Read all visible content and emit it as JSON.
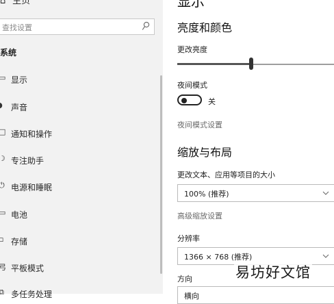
{
  "sidebar": {
    "home_label": "主页",
    "search_placeholder": "查找设置",
    "group_title": "系统",
    "items": [
      {
        "icon": "display-icon",
        "glyph": "▭",
        "label": "显示"
      },
      {
        "icon": "speaker-icon",
        "glyph": "◗",
        "label": "声音"
      },
      {
        "icon": "notifications-icon",
        "glyph": "□",
        "label": "通知和操作"
      },
      {
        "icon": "focus-assist-icon",
        "glyph": "☽",
        "label": "专注助手"
      },
      {
        "icon": "power-icon",
        "glyph": "⏻",
        "label": "电源和睡眠"
      },
      {
        "icon": "battery-icon",
        "glyph": "▭",
        "label": "电池"
      },
      {
        "icon": "storage-icon",
        "glyph": "▫",
        "label": "存储"
      },
      {
        "icon": "tablet-mode-icon",
        "glyph": "弓",
        "label": "平板模式"
      },
      {
        "icon": "multitasking-icon",
        "glyph": "⧉",
        "label": "多任务处理"
      }
    ]
  },
  "main": {
    "title": "显示",
    "brightness_section": "亮度和颜色",
    "brightness_label": "更改亮度",
    "brightness_value_pct": 47,
    "night_light_label": "夜间模式",
    "night_light_state": "关",
    "night_light_settings_link": "夜间模式设置",
    "scale_section": "缩放与布局",
    "scale_label": "更改文本、应用等项目的大小",
    "scale_value": "100% (推荐)",
    "advanced_scaling_link": "高级缩放设置",
    "resolution_label": "分辨率",
    "resolution_value": "1366 × 768 (推荐)",
    "orientation_label": "方向",
    "orientation_value": "横向"
  },
  "watermark": "易坊好文馆"
}
